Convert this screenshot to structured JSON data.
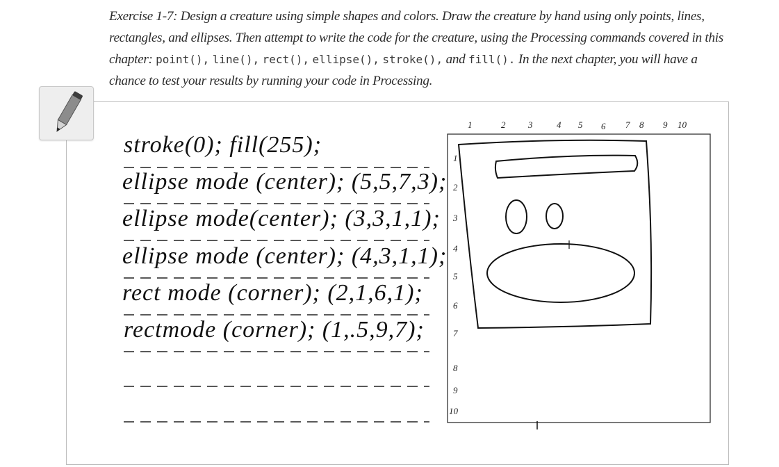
{
  "exercise": {
    "prefix": "Exercise 1-7: Design a creature using simple shapes and colors. Draw the creature by hand using only points, lines, rectangles, and ellipses. Then attempt to write the code for the creature, using the Processing commands covered in this chapter:",
    "commands": [
      "point(),",
      "line(),",
      "rect(),",
      "ellipse(),",
      "stroke(),",
      "and",
      "fill()."
    ],
    "suffix": "In the next chapter, you will have a chance to test your results by running your code in Processing."
  },
  "icons": {
    "pencil": "pencil-icon"
  },
  "handwriting": {
    "lines": [
      "stroke(0); fill(255);",
      "ellipse mode (center); (5,5,7,3);",
      "ellipse mode(center); (3,3,1,1);",
      "ellipse mode (center); (4,3,1,1);",
      "rect mode (corner); (2,1,6,1);",
      "rectmode (corner); (1,.5,9,7);"
    ]
  },
  "grid": {
    "x_labels": [
      "1",
      "2",
      "3",
      "4",
      "5",
      "6",
      "7",
      "8",
      "9",
      "10"
    ],
    "y_labels": [
      "1",
      "2",
      "3",
      "4",
      "5",
      "6",
      "7",
      "8",
      "9",
      "10"
    ]
  }
}
